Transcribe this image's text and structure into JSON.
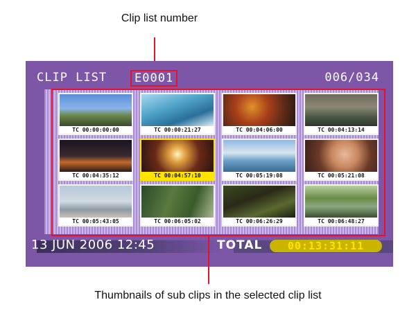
{
  "callouts": {
    "top": "Clip list number",
    "bottom": "Thumbnails of sub clips in the selected clip list"
  },
  "header": {
    "title": "CLIP LIST",
    "clip_list_number": "E0001",
    "count": "006/034"
  },
  "thumbnails": [
    {
      "timecode": "TC 00:00:00:00",
      "scene": "sky-landscape",
      "selected": false
    },
    {
      "timecode": "TC 00:00:21:27",
      "scene": "water-pool",
      "selected": false
    },
    {
      "timecode": "TC 00:04:06:00",
      "scene": "coral-reef",
      "selected": false
    },
    {
      "timecode": "TC 00:04:13:14",
      "scene": "street-aerial",
      "selected": false
    },
    {
      "timecode": "TC 00:04:35:12",
      "scene": "night-room",
      "selected": false
    },
    {
      "timecode": "TC 00:04:57:10",
      "scene": "chandelier",
      "selected": true
    },
    {
      "timecode": "TC 00:05:19:08",
      "scene": "stadium",
      "selected": false
    },
    {
      "timecode": "TC 00:05:21:08",
      "scene": "portrait",
      "selected": false
    },
    {
      "timecode": "TC 00:05:43:05",
      "scene": "beach",
      "selected": false
    },
    {
      "timecode": "TC 00:06:05:02",
      "scene": "forest",
      "selected": false
    },
    {
      "timecode": "TC 00:06:26:29",
      "scene": "jungle-dark",
      "selected": false
    },
    {
      "timecode": "TC 00:06:48:27",
      "scene": "waterfall-trees",
      "selected": false
    }
  ],
  "footer": {
    "date": "13 JUN 2006 12:45",
    "total_label": "TOTAL",
    "total_value": "00:13:31:11"
  },
  "colors": {
    "screen_bg": "#7d56a8",
    "highlight": "#e8102a",
    "selected": "#ffe400"
  }
}
